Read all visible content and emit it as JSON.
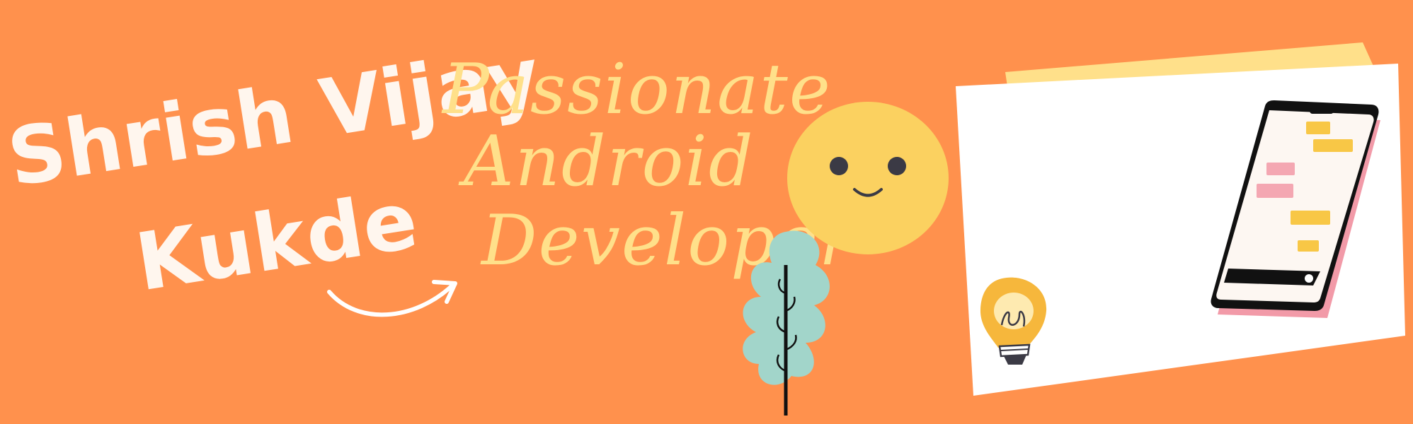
{
  "banner": {
    "background_color": "#FF914D",
    "name_lines": [
      "Shrish Vijay",
      "Kukde"
    ],
    "tagline_lines": [
      "Passionate",
      "Android",
      "Developer"
    ],
    "name_color": "#FFF6EE",
    "tagline_color": "#FFE08A"
  },
  "illustrations": {
    "arrow": "curved-arrow-icon",
    "smiley": "smiley-face-icon",
    "leaf": "leaf-icon",
    "lightbulb": "lightbulb-icon",
    "phone": "smartphone-chat-icon",
    "smiley_color": "#FBD160",
    "leaf_color": "#A2D5CA",
    "bulb_color": "#F6B73C",
    "chat_bubble_yellow": "#F8C746",
    "chat_bubble_pink": "#F4A7B2",
    "phone_shadow_color": "#F29AA8"
  }
}
